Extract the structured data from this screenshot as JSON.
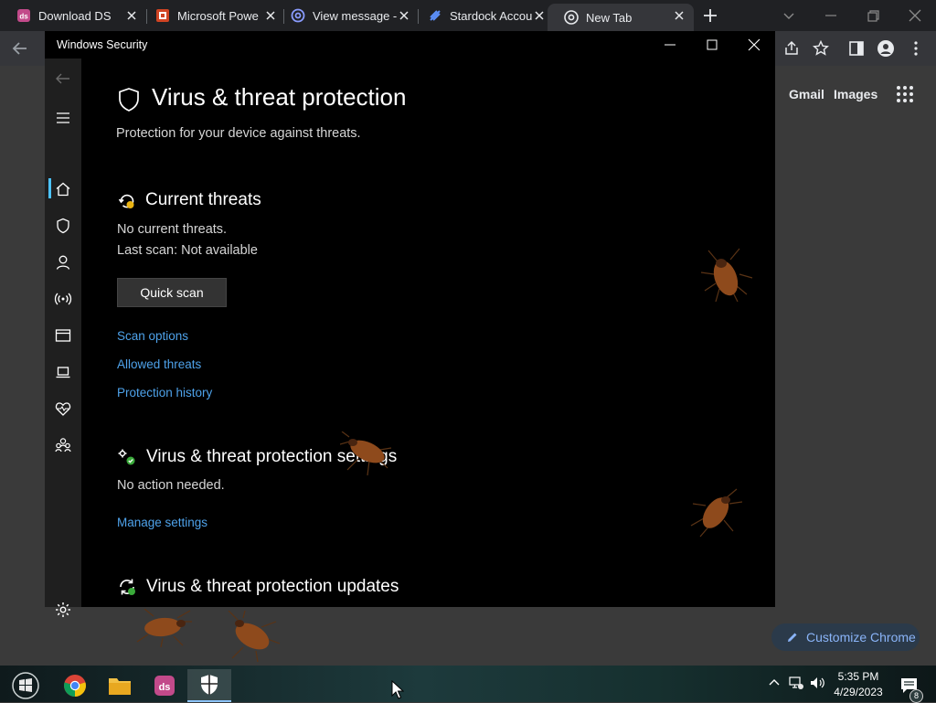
{
  "chrome": {
    "tabs": [
      {
        "title": "Download DS",
        "icon": "ds-icon"
      },
      {
        "title": "Microsoft Powe",
        "icon": "powerpoint-icon"
      },
      {
        "title": "View message -",
        "icon": "at-sign-icon"
      },
      {
        "title": "Stardock Accou",
        "icon": "stardock-icon"
      },
      {
        "title": "New Tab",
        "icon": "chrome-icon"
      }
    ],
    "gmail": "Gmail",
    "images": "Images",
    "customize": "Customize Chrome"
  },
  "security": {
    "window_title": "Windows Security",
    "heading": "Virus & threat protection",
    "subtitle": "Protection for your device against threats.",
    "current_threats": {
      "title": "Current threats",
      "status": "No current threats.",
      "last_scan": "Last scan: Not available",
      "quick_scan": "Quick scan",
      "links": [
        "Scan options",
        "Allowed threats",
        "Protection history"
      ]
    },
    "settings": {
      "title": "Virus & threat protection settings",
      "status": "No action needed.",
      "link": "Manage settings"
    },
    "updates": {
      "title": "Virus & threat protection updates"
    }
  },
  "taskbar": {
    "time": "5:35 PM",
    "date": "4/29/2023",
    "notifications": "8"
  },
  "colors": {
    "accent_link": "#4ea2ea",
    "nav_selection": "#4cc2ff",
    "window_bg": "#000000",
    "chrome_bg": "#202124"
  }
}
